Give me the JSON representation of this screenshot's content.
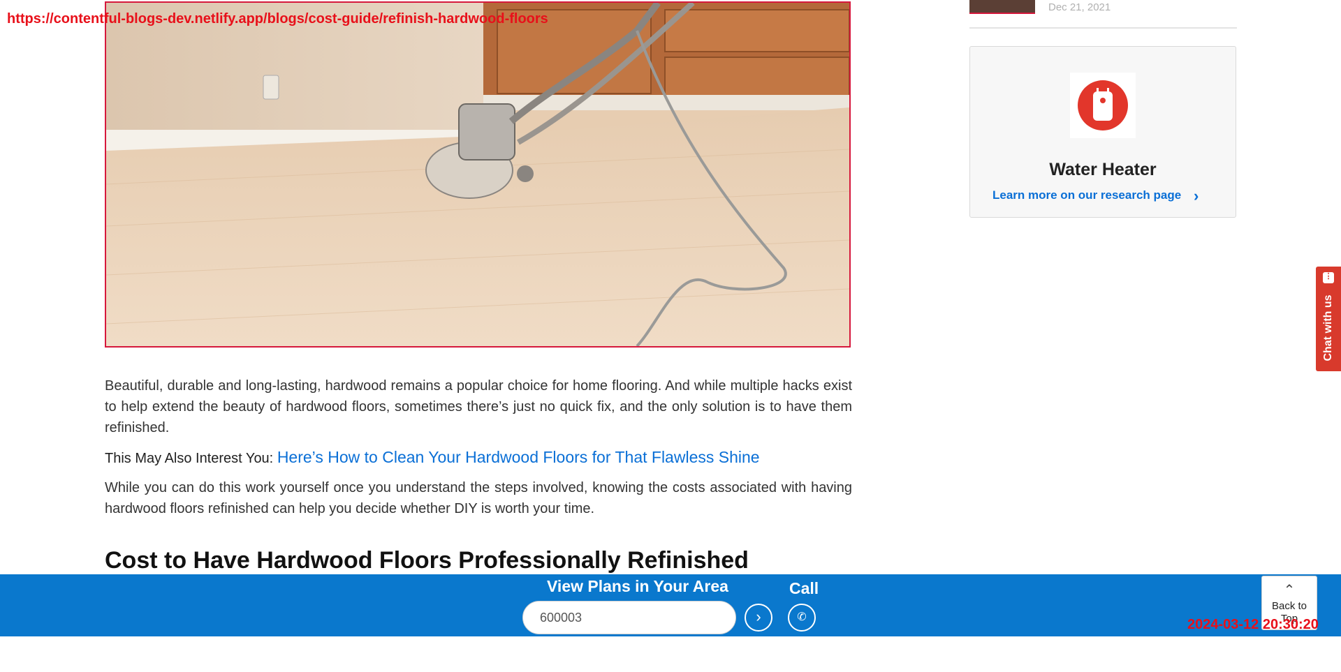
{
  "overlay": {
    "url": "https://contentful-blogs-dev.netlify.app/blogs/cost-guide/refinish-hardwood-floors",
    "timestamp": "2024-03-12 20:30:20"
  },
  "hero": {
    "alt": "Floor sanding machine on light hardwood floor"
  },
  "article": {
    "paragraph_1": "Beautiful, durable and long-lasting, hardwood remains a popular choice for home flooring. And while multiple hacks exist to help extend the beauty of hardwood floors, sometimes there’s just no quick fix, and the only solution is to have them refinished.",
    "interest_label": "This May Also Interest You:",
    "interest_link": "Here’s How to Clean Your Hardwood Floors for That Flawless Shine",
    "paragraph_2": "While you can do this work yourself once you understand the steps involved, knowing the costs associated with having hardwood floors refinished can help you decide whether DIY is worth your time.",
    "heading": "Cost to Have Hardwood Floors Professionally Refinished"
  },
  "sidebar": {
    "recent_post_date": "Dec 21, 2021",
    "card": {
      "icon": "water-heater-icon",
      "title": "Water Heater",
      "link": "Learn more on our research page"
    }
  },
  "chat": {
    "label": "Chat with us",
    "icon": "chat-bubble-icon"
  },
  "bottom_bar": {
    "title": "View Plans in Your Area",
    "zip_value": "600003",
    "call_label": "Call",
    "colors": {
      "bar": "#0a78cd",
      "accent_red": "#d83a2c"
    }
  },
  "back_to_top": {
    "label": "Back to Top"
  }
}
